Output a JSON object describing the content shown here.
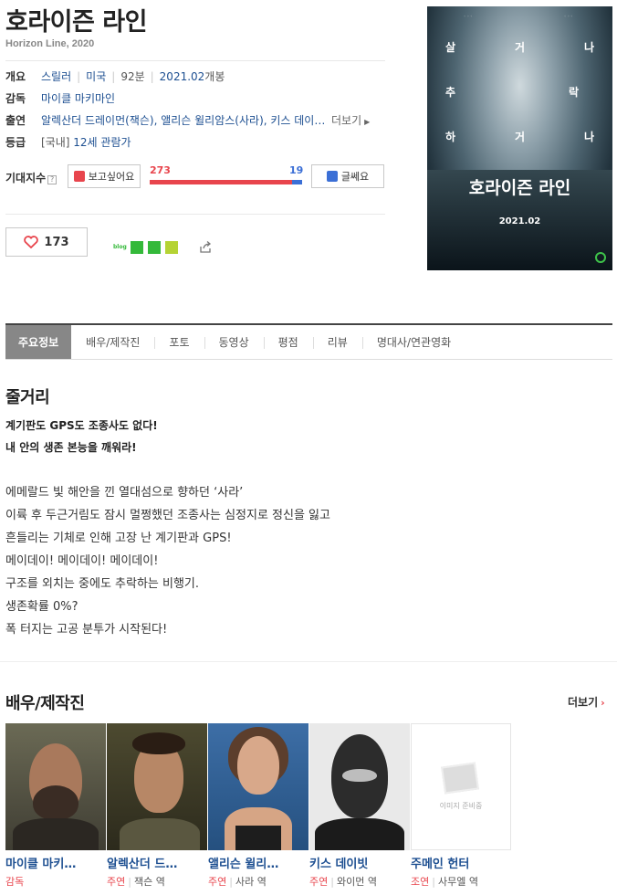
{
  "movie": {
    "title": "호라이즌 라인",
    "subtitle": "Horizon Line, 2020"
  },
  "info": {
    "overview_label": "개요",
    "genre": "스릴러",
    "country": "미국",
    "runtime": "92분",
    "release_date": "2021.02",
    "release_suffix": "개봉",
    "director_label": "감독",
    "director": "마이클 마키마인",
    "cast_label": "출연",
    "cast_line": "알렉산더 드레이먼(잭슨), 앨리슨 윌리암스(사라), 키스 데이…",
    "cast_more": "더보기",
    "rating_label": "등급",
    "rating_prefix": "[국내]",
    "rating": "12세 관람가"
  },
  "expectation": {
    "label": "기대지수",
    "want_label": "보고싶어요",
    "nah_label": "글쎄요",
    "want_count": "273",
    "nah_count": "19",
    "want_ratio": 0.935
  },
  "like": {
    "count": "173"
  },
  "share": {
    "blog_label": "blog"
  },
  "poster": {
    "title": "호라이즌 라인",
    "date": "2021.02",
    "col_left": [
      "살",
      "추",
      "하"
    ],
    "col_mid": [
      "거",
      "락",
      "거"
    ],
    "col_right": [
      "나",
      "",
      "나"
    ]
  },
  "tabs": [
    "주요정보",
    "배우/제작진",
    "포토",
    "동영상",
    "평점",
    "리뷰",
    "명대사/연관영화"
  ],
  "synopsis": {
    "heading": "줄거리",
    "tagline1": "계기판도 GPS도 조종사도 없다!",
    "tagline2": "내 안의 생존 본능을 깨워라!",
    "lines": [
      "에메랄드 빛 해안을 낀 열대섬으로 향하던 ‘사라’",
      " 이륙 후 두근거림도 잠시 멀쩡했던 조종사는 심정지로 정신을 잃고",
      " 흔들리는 기체로 인해 고장 난 계기판과 GPS!",
      " 메이데이! 메이데이! 메이데이!",
      " 구조를 외치는 중에도 추락하는 비행기.",
      " 생존확률 0%?",
      " 폭 터지는 고공 분투가 시작된다!"
    ]
  },
  "cast_section": {
    "heading": "배우/제작진",
    "more": "더보기",
    "placeholder_text": "이미지 준비중",
    "members": [
      {
        "name": "마이클 마키…",
        "role": "감독",
        "character": ""
      },
      {
        "name": "알렉산더 드…",
        "role": "주연",
        "character": "잭슨 역"
      },
      {
        "name": "앨리슨 윌리…",
        "role": "주연",
        "character": "사라 역"
      },
      {
        "name": "키스 데이빗",
        "role": "주연",
        "character": "와이먼 역"
      },
      {
        "name": "주메인 헌터",
        "role": "조연",
        "character": "사무엘 역"
      }
    ]
  }
}
